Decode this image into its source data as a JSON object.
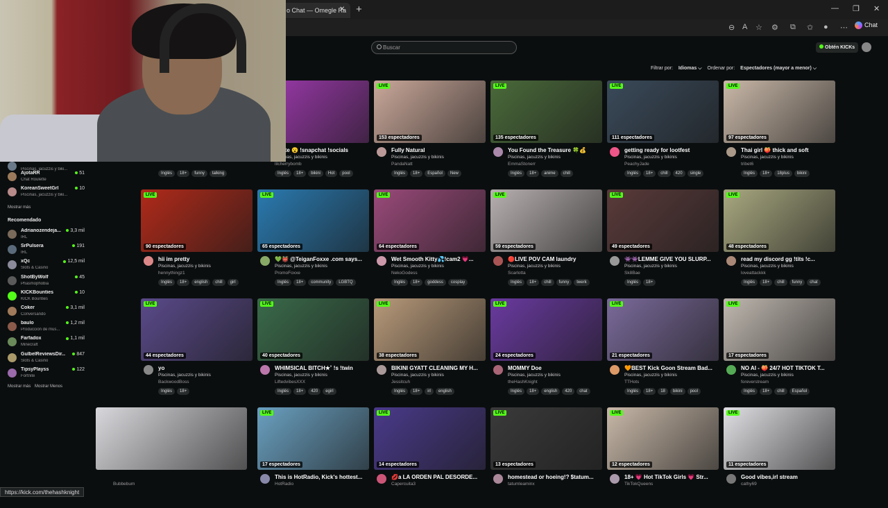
{
  "browser": {
    "tab_title": "o Chat — Omegle Ra",
    "tab_close": "✕",
    "new_tab": "+",
    "chat_label": "Chat",
    "minimize": "—",
    "restore": "❐",
    "close": "✕"
  },
  "header": {
    "search_placeholder": "Buscar",
    "kicks_label": "Obtén KICKs"
  },
  "filters": {
    "filter_by": "Filtrar por:",
    "languages": "Idiomas ⌵",
    "order_by": "Ordenar por:",
    "order_value": "Espectadores (mayor a menor) ⌵"
  },
  "sidebar": {
    "following_items": [
      {
        "name": "",
        "category": "Piscinas, jacuzzis y biki...",
        "viewers": "",
        "color": "#6a7a8a"
      },
      {
        "name": "AjotaRR",
        "category": "Chat Roulette",
        "viewers": "51",
        "color": "#9a7a5a"
      },
      {
        "name": "KoreanSweetGrl",
        "category": "Piscinas, jacuzzis y biki...",
        "viewers": "10",
        "color": "#b88a8a"
      }
    ],
    "show_more_1": "Mostrar más",
    "recommended_title": "Recomendado",
    "recommended": [
      {
        "name": "Adrianozendeja...",
        "category": "IRL",
        "viewers": "3,3 mil",
        "color": "#7a6a5a"
      },
      {
        "name": "SrPulsera",
        "category": "IRL",
        "viewers": "191",
        "color": "#5a6a7a"
      },
      {
        "name": "xQc",
        "category": "Slots & Casino",
        "viewers": "12,5 mil",
        "color": "#8a8a9a"
      },
      {
        "name": "ShotByWolf",
        "category": "Phasmophobia",
        "viewers": "45",
        "color": "#5a5a5a"
      },
      {
        "name": "KICKBounties",
        "category": "KICK Bounties",
        "viewers": "10",
        "color": "#53fc18"
      },
      {
        "name": "Coker",
        "category": "Conversando",
        "viewers": "3,1 mil",
        "color": "#a07a5a"
      },
      {
        "name": "baulo",
        "category": "Producción de mús...",
        "viewers": "1,2 mil",
        "color": "#8a5a4a"
      },
      {
        "name": "Farfadox",
        "category": "Minecraft",
        "viewers": "1,1 mil",
        "color": "#6a8a5a"
      },
      {
        "name": "GulbelReviewsDir...",
        "category": "Slots & Casino",
        "viewers": "847",
        "color": "#aa9a6a"
      },
      {
        "name": "TipsyPlayss",
        "category": "Fortnite",
        "viewers": "122",
        "color": "#9a6aaa"
      }
    ],
    "show_more_2": "Mostrar más",
    "show_less": "Mostrar Menos"
  },
  "cards": [
    {
      "viewers": "",
      "title": "",
      "category": "",
      "channel": "Pennygameplay",
      "tags": [
        "Inglés",
        "18+",
        "funny",
        "talking"
      ],
      "thumb": "#6a5a6a",
      "av": "#777"
    },
    {
      "viewers": "",
      "title": "vorite 😮 !snapchat !socials",
      "category": "Piscinas, jacuzzis y bikinis",
      "channel": "lilcherrybomb",
      "tags": [
        "Inglés",
        "18+",
        "bikini",
        "Hot",
        "pool"
      ],
      "thumb": "#a03ab0",
      "av": "#c88"
    },
    {
      "viewers": "153 espectadores",
      "title": "Fully Natural",
      "category": "Piscinas, jacuzzis y bikinis",
      "channel": "PandaNatt",
      "tags": [
        "Inglés",
        "18+",
        "Español",
        "New"
      ],
      "thumb": "#caa89a",
      "av": "#b99"
    },
    {
      "viewers": "135 espectadores",
      "title": "You Found the Treasure 🍀💰",
      "category": "Piscinas, jacuzzis y bikinis",
      "channel": "EmmaStonerr",
      "tags": [
        "Inglés",
        "18+",
        "anime",
        "chill"
      ],
      "thumb": "#4a6a3a",
      "av": "#a8a"
    },
    {
      "viewers": "111 espectadores",
      "title": "getting ready for lootfest",
      "category": "Piscinas, jacuzzis y bikinis",
      "channel": "PeachyJade",
      "tags": [
        "Inglés",
        "18+",
        "chill",
        "420",
        "single"
      ],
      "thumb": "#3a4a5a",
      "av": "#e58"
    },
    {
      "viewers": "97 espectadores",
      "title": "Thai girl 🍑 thick and soft",
      "category": "Piscinas, jacuzzis y bikinis",
      "channel": "tribet6",
      "tags": [
        "Inglés",
        "18+",
        "18plus",
        "bikini"
      ],
      "thumb": "#c9b8a8",
      "av": "#a98"
    },
    {
      "viewers": "90 espectadores",
      "title": "hii im pretty",
      "category": "Piscinas, jacuzzis y bikinis",
      "channel": "hennythingz1",
      "tags": [
        "Inglés",
        "18+",
        "english",
        "chill",
        "girl"
      ],
      "thumb": "#b02a1a",
      "av": "#d88"
    },
    {
      "viewers": "65 espectadores",
      "title": "💚👹 @TeiganFoxxe .com says...",
      "category": "Piscinas, jacuzzis y bikinis",
      "channel": "PromoFoxxe",
      "tags": [
        "Inglés",
        "18+",
        "community",
        "LGBTQ"
      ],
      "thumb": "#2a7ab0",
      "av": "#8a6"
    },
    {
      "viewers": "64 espectadores",
      "title": "Wet Smooth Kitty💦!cam2 💗...",
      "category": "Piscinas, jacuzzis y bikinis",
      "channel": "NekoGodess",
      "tags": [
        "Inglés",
        "18+",
        "goddess",
        "cosplay"
      ],
      "thumb": "#9a4a7a",
      "av": "#c9a"
    },
    {
      "viewers": "59 espectadores",
      "title": "🔴LIVE POV CAM laundry",
      "category": "Piscinas, jacuzzis y bikinis",
      "channel": "Scarlotta",
      "tags": [
        "Inglés",
        "18+",
        "chill",
        "funny",
        "twerk"
      ],
      "thumb": "#b8b0b0",
      "av": "#a55"
    },
    {
      "viewers": "49 espectadores",
      "title": "👾👾LEMME GIVE YOU SLURP...",
      "category": "Piscinas, jacuzzis y bikinis",
      "channel": "Sk8Bae",
      "tags": [
        "Inglés",
        "18+"
      ],
      "thumb": "#5a3a3a",
      "av": "#999"
    },
    {
      "viewers": "48 espectadores",
      "title": "read my discord gg !tits !c...",
      "category": "Piscinas, jacuzzis y bikinis",
      "channel": "loveattackkk",
      "tags": [
        "Inglés",
        "18+",
        "chill",
        "funny",
        "chat"
      ],
      "thumb": "#a8a880",
      "av": "#a87"
    },
    {
      "viewers": "44 espectadores",
      "title": "yo",
      "category": "Piscinas, jacuzzis y bikinis",
      "channel": "BackwoodBoss",
      "tags": [
        "Inglés",
        "18+"
      ],
      "thumb": "#5a4a8a",
      "av": "#888"
    },
    {
      "viewers": "40 espectadores",
      "title": "WHIMSICAL BITCH★˚ !s !twin",
      "category": "Piscinas, jacuzzis y bikinis",
      "channel": "LiftedvibesXXX",
      "tags": [
        "Inglés",
        "18+",
        "420",
        "egirl"
      ],
      "thumb": "#3a6a4a",
      "av": "#b7a"
    },
    {
      "viewers": "38 espectadores",
      "title": "BIKINI GYATT CLEANING MY H...",
      "category": "Piscinas, jacuzzis y bikinis",
      "channel": "Jessitcuh",
      "tags": [
        "Inglés",
        "18+",
        "irl",
        "english"
      ],
      "thumb": "#b89a7a",
      "av": "#a99"
    },
    {
      "viewers": "24 espectadores",
      "title": "MOMMY Doe",
      "category": "Piscinas, jacuzzis y bikinis",
      "channel": "theHashKnight",
      "tags": [
        "Inglés",
        "18+",
        "english",
        "420",
        "chat"
      ],
      "thumb": "#6a3aa0",
      "av": "#a67"
    },
    {
      "viewers": "21 espectadores",
      "title": "🧡BEST Kick Goon Stream Bad...",
      "category": "Piscinas, jacuzzis y bikinis",
      "channel": "TTHots",
      "tags": [
        "Inglés",
        "18+",
        "18",
        "bikini",
        "pool"
      ],
      "thumb": "#7a6a9a",
      "av": "#d96"
    },
    {
      "viewers": "17 espectadores",
      "title": "NO AI - 🍑 24/7 HOT TIKTOK T...",
      "category": "Piscinas, jacuzzis y bikinis",
      "channel": "foreverstream",
      "tags": [
        "Inglés",
        "18+",
        "chill",
        "Español"
      ],
      "thumb": "#c0b8b0",
      "av": "#5a5"
    },
    {
      "viewers": "",
      "title": "",
      "category": "",
      "channel": "Bubbebum",
      "tags": [],
      "thumb": "#d8d8dc",
      "av": "#999"
    },
    {
      "viewers": "17 espectadores",
      "title": "This is HotRadio, Kick's hottest...",
      "category": "",
      "channel": "HotRadio",
      "tags": [],
      "thumb": "#6aa0c0",
      "av": "#88a"
    },
    {
      "viewers": "14 espectadores",
      "title": "💋a LA ORDEN PAL DESORDE...",
      "category": "",
      "channel": "Capercuita3",
      "tags": [],
      "thumb": "#4a3a8a",
      "av": "#c57"
    },
    {
      "viewers": "13 espectadores",
      "title": "homestead or hoeing!? $tatum...",
      "category": "",
      "channel": "tatumleaminx",
      "tags": [],
      "thumb": "#3a3a3a",
      "av": "#a89"
    },
    {
      "viewers": "12 espectadores",
      "title": "18+ 💗 Hot TikTok Girls 💗 Str...",
      "category": "",
      "channel": "TikTokQueens",
      "tags": [],
      "thumb": "#c8b8a8",
      "av": "#a9a"
    },
    {
      "viewers": "11 espectadores",
      "title": "Good vibes,irl stream",
      "category": "",
      "channel": "cathy69",
      "tags": [],
      "thumb": "#e0e0e4",
      "av": "#777"
    }
  ],
  "live_label": "LIVE",
  "status_url": "https://kick.com/thehashknight"
}
